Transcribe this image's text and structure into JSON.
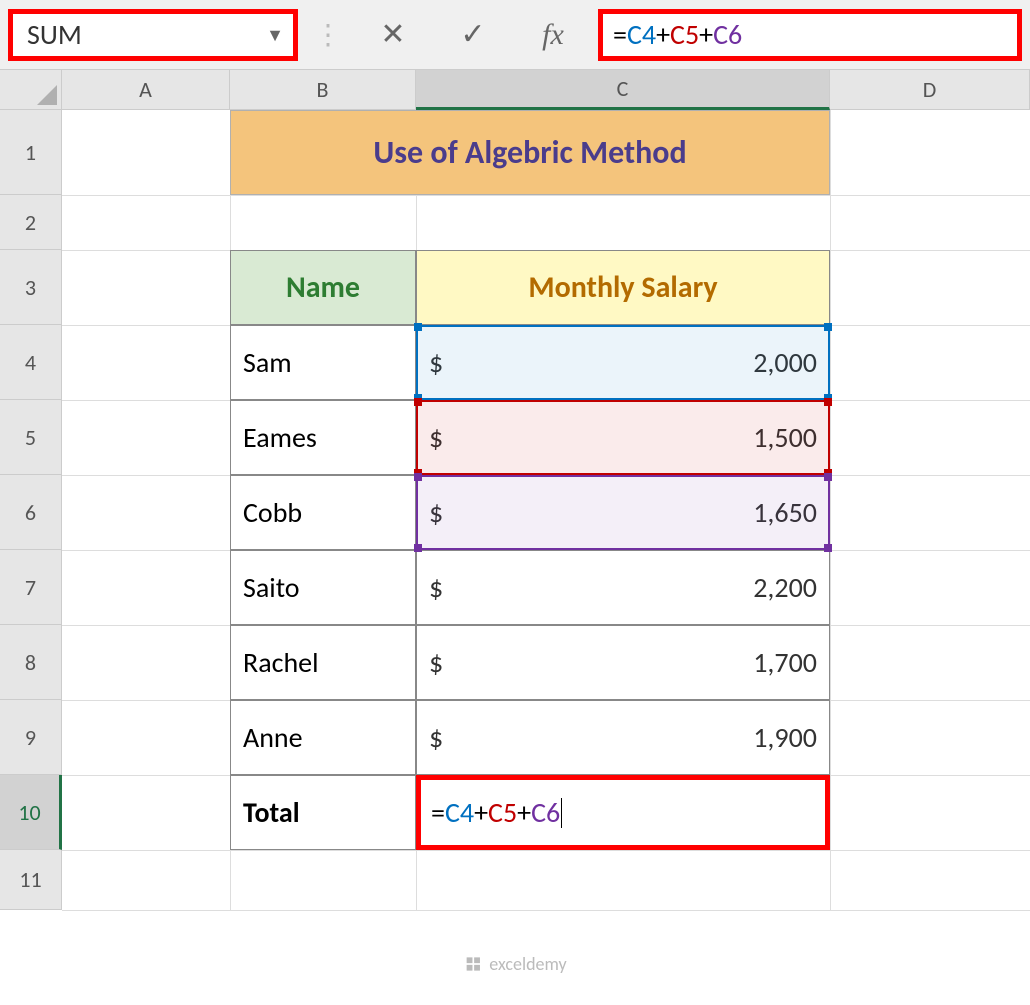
{
  "formula_bar": {
    "name_box": "SUM",
    "cancel_icon": "✕",
    "enter_icon": "✓",
    "fx_label": "fx",
    "formula_equals": "=",
    "formula_ref1": "C4",
    "formula_plus": "+",
    "formula_ref2": "C5",
    "formula_ref3": "C6"
  },
  "columns": {
    "A": "A",
    "B": "B",
    "C": "C",
    "D": "D"
  },
  "rows": {
    "r1": "1",
    "r2": "2",
    "r3": "3",
    "r4": "4",
    "r5": "5",
    "r6": "6",
    "r7": "7",
    "r8": "8",
    "r9": "9",
    "r10": "10",
    "r11": "11"
  },
  "title": "Use of Algebric Method",
  "headers": {
    "name": "Name",
    "salary": "Monthly Salary"
  },
  "currency": "$",
  "people": [
    {
      "name": "Sam",
      "salary": "2,000"
    },
    {
      "name": "Eames",
      "salary": "1,500"
    },
    {
      "name": "Cobb",
      "salary": "1,650"
    },
    {
      "name": "Saito",
      "salary": "2,200"
    },
    {
      "name": "Rachel",
      "salary": "1,700"
    },
    {
      "name": "Anne",
      "salary": "1,900"
    }
  ],
  "total_label": "Total",
  "watermark": "exceldemy"
}
